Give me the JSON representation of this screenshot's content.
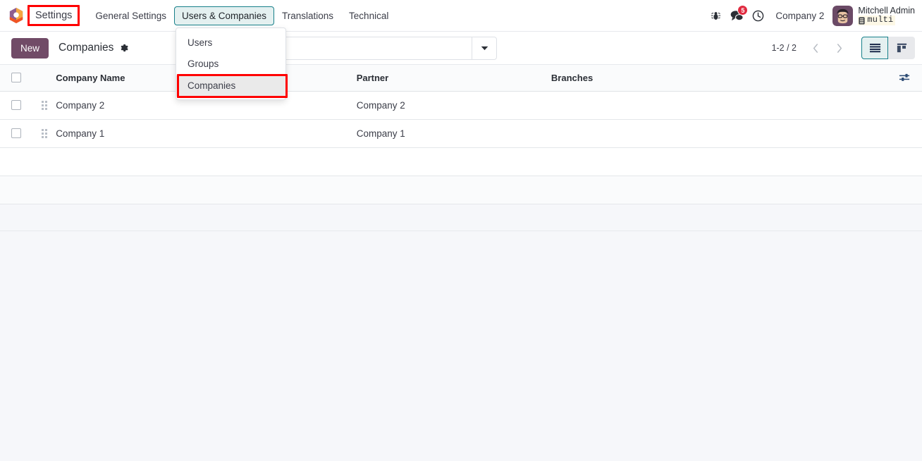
{
  "navbar": {
    "logo_icon": "odoo-logo-icon",
    "app_name": "Settings",
    "menu_items": [
      {
        "label": "General Settings",
        "active": false
      },
      {
        "label": "Users & Companies",
        "active": true
      },
      {
        "label": "Translations",
        "active": false
      },
      {
        "label": "Technical",
        "active": false
      }
    ],
    "bug_icon": "bug-icon",
    "messages_icon": "chat-bubbles-icon",
    "messages_badge": "5",
    "activities_icon": "clock-icon",
    "company_selector": "Company 2",
    "user_name": "Mitchell Admin",
    "database_icon": "database-icon",
    "database_name": "multi",
    "avatar_icon": "user-avatar"
  },
  "dropdown": {
    "items": [
      {
        "label": "Users",
        "focused": false
      },
      {
        "label": "Groups",
        "focused": false
      },
      {
        "label": "Companies",
        "focused": true
      }
    ]
  },
  "control_panel": {
    "new_label": "New",
    "breadcrumb_title": "Companies",
    "gear_icon": "gear-icon",
    "search": {
      "icon": "search-icon",
      "value": "",
      "placeholder": "Search...",
      "toggle_icon": "caret-down-icon"
    },
    "pager": {
      "count": "1-2 / 2",
      "prev_icon": "chevron-left-icon",
      "next_icon": "chevron-right-icon"
    },
    "views": [
      {
        "name": "list",
        "icon": "list-view-icon",
        "active": true
      },
      {
        "name": "kanban",
        "icon": "kanban-view-icon",
        "active": false
      }
    ]
  },
  "list": {
    "columns": [
      "Company Name",
      "Partner",
      "Branches"
    ],
    "optional_columns_icon": "sliders-icon",
    "rows": [
      {
        "company_name": "Company 2",
        "partner": "Company 2",
        "branches": ""
      },
      {
        "company_name": "Company 1",
        "partner": "Company 1",
        "branches": ""
      }
    ]
  },
  "highlights": {
    "settings": "red-highlight-box",
    "companies": "red-highlight-box"
  },
  "colors": {
    "brand_primary": "#714b67",
    "accent_teal": "#17808a",
    "badge_red": "#e02b40",
    "highlight_red": "#ff0000"
  }
}
